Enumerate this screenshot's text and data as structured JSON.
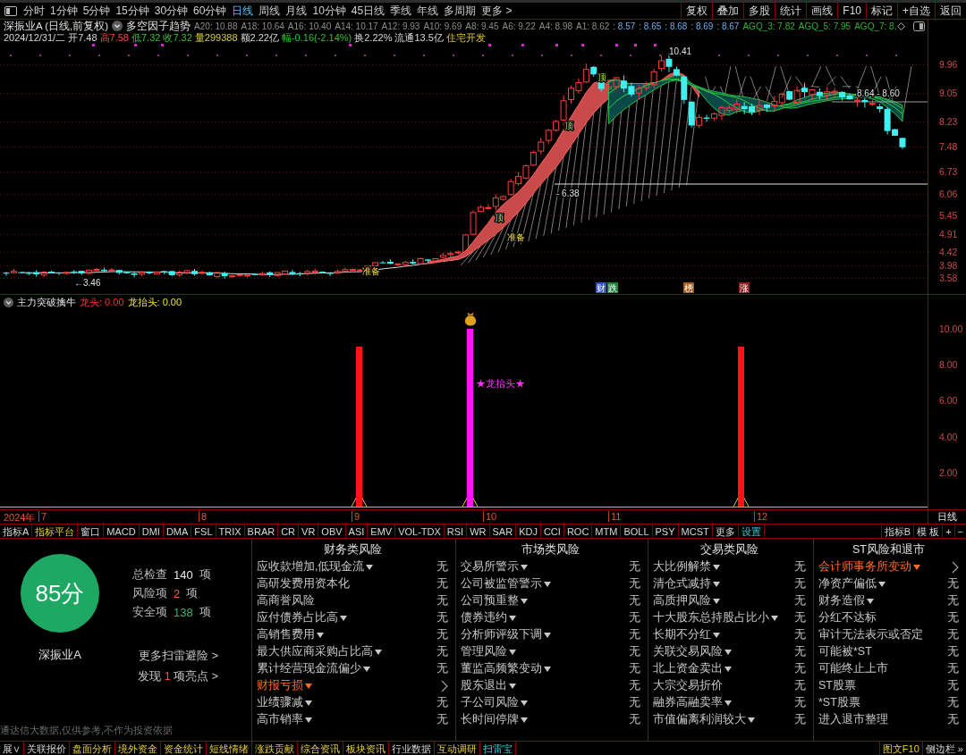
{
  "toolbar": {
    "periods": [
      {
        "label": "分时",
        "selected": false
      },
      {
        "label": "1分钟",
        "selected": false
      },
      {
        "label": "5分钟",
        "selected": false
      },
      {
        "label": "15分钟",
        "selected": false
      },
      {
        "label": "30分钟",
        "selected": false
      },
      {
        "label": "60分钟",
        "selected": false
      },
      {
        "label": "日线",
        "selected": true
      },
      {
        "label": "周线",
        "selected": false
      },
      {
        "label": "月线",
        "selected": false
      },
      {
        "label": "10分钟",
        "selected": false
      },
      {
        "label": "45日线",
        "selected": false
      },
      {
        "label": "季线",
        "selected": false
      },
      {
        "label": "年线",
        "selected": false
      },
      {
        "label": "多周期",
        "selected": false
      }
    ],
    "more": "更多 >",
    "tools": [
      "复权",
      "叠加",
      "多股",
      "统计",
      "画线",
      "F10",
      "标记",
      "+自选",
      "返回"
    ]
  },
  "quote_header": {
    "title": "深振业A (日线,前复权)",
    "indicator": "多空因子趋势",
    "indicator_values": [
      {
        "text": "A20: 10.88",
        "kind": "average"
      },
      {
        "text": "A18: 10.64",
        "kind": "average"
      },
      {
        "text": "A16: 10.40",
        "kind": "average"
      },
      {
        "text": "A14: 10.17",
        "kind": "average"
      },
      {
        "text": "A12: 9.93",
        "kind": "average"
      },
      {
        "text": "A10: 9.69",
        "kind": "average"
      },
      {
        "text": "A8: 9.45",
        "kind": "average"
      },
      {
        "text": "A6: 9.22",
        "kind": "average"
      },
      {
        "text": "A4: 8.98",
        "kind": "average"
      },
      {
        "text": "A1: 8.62",
        "kind": "average"
      },
      {
        "text": ": 8.57",
        "kind": "level"
      },
      {
        "text": ": 8.65",
        "kind": "level"
      },
      {
        "text": ": 8.68",
        "kind": "level"
      },
      {
        "text": ": 8.69",
        "kind": "level"
      },
      {
        "text": ": 8.67",
        "kind": "level"
      },
      {
        "text": "AGQ_3: 7.82",
        "kind": "agq"
      },
      {
        "text": "AGQ_5: 7.95",
        "kind": "agq"
      },
      {
        "text": "AGQ_7: 8.",
        "kind": "agq"
      }
    ],
    "quote": [
      {
        "text": "2024/12/31/二",
        "kind": "plain"
      },
      {
        "text": "开7.48",
        "kind": "plain"
      },
      {
        "text": "高7.58",
        "kind": "up"
      },
      {
        "text": "低7.32",
        "kind": "down"
      },
      {
        "text": "收7.32",
        "kind": "down"
      },
      {
        "text": "量299388",
        "kind": "volume"
      },
      {
        "text": "额2.22亿",
        "kind": "plain"
      },
      {
        "text": "幅-0.16(-2.14%)",
        "kind": "down"
      },
      {
        "text": "换2.22%",
        "kind": "plain"
      },
      {
        "text": "流通13.5亿",
        "kind": "plain"
      },
      {
        "text": "住宅开发",
        "kind": "sector"
      }
    ]
  },
  "price_chart": {
    "axis_labels": [
      "9.96",
      "9.05",
      "8.23",
      "7.48",
      "6.73",
      "6.06",
      "5.45",
      "4.91",
      "4.42",
      "3.98",
      "3.58"
    ],
    "price_labels": [
      "10.41",
      "- 6.38",
      "8.64 - 8.60",
      "←3.46"
    ],
    "signals": [
      {
        "text": "顶",
        "kind": "peak"
      },
      {
        "text": "顶",
        "kind": "peak"
      },
      {
        "text": "顶",
        "kind": "peak"
      },
      {
        "text": "准备",
        "kind": "setup"
      },
      {
        "text": "准备",
        "kind": "setup"
      }
    ],
    "badges": [
      {
        "text": "财",
        "color": "#3050c0"
      },
      {
        "text": "跌",
        "color": "#208040"
      },
      {
        "text": "榜",
        "color": "#a05a20"
      },
      {
        "text": "涨",
        "color": "#902020"
      }
    ]
  },
  "indicator_panel": {
    "name": "主力突破擒牛",
    "values": [
      {
        "text": "龙头: 0.00",
        "kind": "leader"
      },
      {
        "text": "龙抬头: 0.00",
        "kind": "rise"
      }
    ],
    "signal_label": "★龙抬头★",
    "axis_labels": [
      "10.00",
      "8.00",
      "6.00",
      "4.00",
      "2.00"
    ]
  },
  "date_axis": {
    "year": "2024年",
    "months": [
      "7",
      "8",
      "9",
      "10",
      "11",
      "12"
    ],
    "period": "日线"
  },
  "indicator_tabs": {
    "tabs": [
      {
        "label": "指标A",
        "kind": "normal"
      },
      {
        "label": "指标平台",
        "kind": "feature"
      },
      {
        "label": "窗口",
        "kind": "normal"
      },
      {
        "label": "MACD",
        "kind": "normal"
      },
      {
        "label": "DMI",
        "kind": "normal"
      },
      {
        "label": "DMA",
        "kind": "normal"
      },
      {
        "label": "FSL",
        "kind": "normal"
      },
      {
        "label": "TRIX",
        "kind": "normal"
      },
      {
        "label": "BRAR",
        "kind": "normal"
      },
      {
        "label": "CR",
        "kind": "normal"
      },
      {
        "label": "VR",
        "kind": "normal"
      },
      {
        "label": "OBV",
        "kind": "normal"
      },
      {
        "label": "ASI",
        "kind": "normal"
      },
      {
        "label": "EMV",
        "kind": "normal"
      },
      {
        "label": "VOL-TDX",
        "kind": "normal"
      },
      {
        "label": "RSI",
        "kind": "normal"
      },
      {
        "label": "WR",
        "kind": "normal"
      },
      {
        "label": "SAR",
        "kind": "normal"
      },
      {
        "label": "KDJ",
        "kind": "normal"
      },
      {
        "label": "CCI",
        "kind": "normal"
      },
      {
        "label": "ROC",
        "kind": "normal"
      },
      {
        "label": "MTM",
        "kind": "normal"
      },
      {
        "label": "BOLL",
        "kind": "normal"
      },
      {
        "label": "PSY",
        "kind": "normal"
      },
      {
        "label": "MCST",
        "kind": "normal"
      },
      {
        "label": "更多",
        "kind": "normal"
      },
      {
        "label": "设置",
        "kind": "setting"
      }
    ],
    "right": [
      "指标B",
      "模 板",
      "+",
      "−"
    ]
  },
  "risk_scan": {
    "score": "85分",
    "stock": "深振业A",
    "stats": [
      {
        "label": "总检查",
        "value": "140",
        "unit": "项",
        "kind": "total"
      },
      {
        "label": "风险项",
        "value": "2",
        "unit": "项",
        "kind": "risk"
      },
      {
        "label": "安全项",
        "value": "138",
        "unit": "项",
        "kind": "safe"
      }
    ],
    "more_link": "更多扫雷避险 >",
    "highlight": {
      "prefix": "发现",
      "count": "1",
      "suffix": "项亮点 >"
    },
    "disclaimer": "通达信大数据,仅供参考,不作为投资依据",
    "categories": [
      {
        "title": "财务类风险",
        "items": [
          {
            "label": "应收款增加,低现金流",
            "expandable": true,
            "risk": false,
            "status": "无"
          },
          {
            "label": "高研发费用资本化",
            "expandable": false,
            "risk": false,
            "status": "无"
          },
          {
            "label": "高商誉风险",
            "expandable": false,
            "risk": false,
            "status": "无"
          },
          {
            "label": "应付债券占比高",
            "expandable": true,
            "risk": false,
            "status": "无"
          },
          {
            "label": "高销售费用",
            "expandable": true,
            "risk": false,
            "status": "无"
          },
          {
            "label": "最大供应商采购占比高",
            "expandable": true,
            "risk": false,
            "status": "无"
          },
          {
            "label": "累计经营现金流偏少",
            "expandable": true,
            "risk": false,
            "status": "无"
          },
          {
            "label": "财报亏损",
            "expandable": true,
            "risk": true
          },
          {
            "label": "业绩骤减",
            "expandable": true,
            "risk": false,
            "status": "无"
          },
          {
            "label": "高市销率",
            "expandable": true,
            "risk": false,
            "status": "无"
          }
        ]
      },
      {
        "title": "市场类风险",
        "items": [
          {
            "label": "交易所警示",
            "expandable": true,
            "risk": false,
            "status": "无"
          },
          {
            "label": "公司被监管警示",
            "expandable": true,
            "risk": false,
            "status": "无"
          },
          {
            "label": "公司预重整",
            "expandable": true,
            "risk": false,
            "status": "无"
          },
          {
            "label": "债券违约",
            "expandable": true,
            "risk": false,
            "status": "无"
          },
          {
            "label": "分析师评级下调",
            "expandable": true,
            "risk": false,
            "status": "无"
          },
          {
            "label": "管理风险",
            "expandable": true,
            "risk": false,
            "status": "无"
          },
          {
            "label": "董监高频繁变动",
            "expandable": true,
            "risk": false,
            "status": "无"
          },
          {
            "label": "股东退出",
            "expandable": true,
            "risk": false,
            "status": "无"
          },
          {
            "label": "子公司风险",
            "expandable": true,
            "risk": false,
            "status": "无"
          },
          {
            "label": "长时间停牌",
            "expandable": true,
            "risk": false,
            "status": "无"
          }
        ]
      },
      {
        "title": "交易类风险",
        "items": [
          {
            "label": "大比例解禁",
            "expandable": true,
            "risk": false,
            "status": "无"
          },
          {
            "label": "清仓式减持",
            "expandable": true,
            "risk": false,
            "status": "无"
          },
          {
            "label": "高质押风险",
            "expandable": true,
            "risk": false,
            "status": "无"
          },
          {
            "label": "十大股东总持股占比小",
            "expandable": true,
            "risk": false,
            "status": "无"
          },
          {
            "label": "长期不分红",
            "expandable": true,
            "risk": false,
            "status": "无"
          },
          {
            "label": "关联交易风险",
            "expandable": true,
            "risk": false,
            "status": "无"
          },
          {
            "label": "北上资金卖出",
            "expandable": true,
            "risk": false,
            "status": "无"
          },
          {
            "label": "大宗交易折价",
            "expandable": false,
            "risk": false,
            "status": "无"
          },
          {
            "label": "融券高融卖率",
            "expandable": true,
            "risk": false,
            "status": "无"
          },
          {
            "label": "市值偏离利润较大",
            "expandable": true,
            "risk": false,
            "status": "无"
          }
        ]
      },
      {
        "title": "ST风险和退市",
        "items": [
          {
            "label": "会计师事务所变动",
            "expandable": true,
            "risk": true
          },
          {
            "label": "净资产偏低",
            "expandable": true,
            "risk": false,
            "status": "无"
          },
          {
            "label": "财务造假",
            "expandable": true,
            "risk": false,
            "status": "无"
          },
          {
            "label": "分红不达标",
            "expandable": false,
            "risk": false,
            "status": "无"
          },
          {
            "label": "审计无法表示或否定",
            "expandable": false,
            "risk": false,
            "status": "无"
          },
          {
            "label": "可能被*ST",
            "expandable": false,
            "risk": false,
            "status": "无"
          },
          {
            "label": "可能终止上市",
            "expandable": false,
            "risk": false,
            "status": "无"
          },
          {
            "label": "ST股票",
            "expandable": false,
            "risk": false,
            "status": "无"
          },
          {
            "label": "*ST股票",
            "expandable": false,
            "risk": false,
            "status": "无"
          },
          {
            "label": "进入退市整理",
            "expandable": false,
            "risk": false,
            "status": "无"
          }
        ]
      }
    ]
  },
  "bottom_tabs": {
    "tabs": [
      {
        "label": "展∨",
        "kind": "normal",
        "selected": false
      },
      {
        "label": "关联报价",
        "kind": "normal",
        "selected": false
      },
      {
        "label": "盘面分析",
        "kind": "feature",
        "selected": false
      },
      {
        "label": "境外资金",
        "kind": "feature",
        "selected": false
      },
      {
        "label": "资金统计",
        "kind": "feature",
        "selected": false
      },
      {
        "label": "短线情绪",
        "kind": "feature",
        "selected": false
      },
      {
        "label": "涨跌贡献",
        "kind": "feature",
        "selected": false
      },
      {
        "label": "综合资讯",
        "kind": "feature",
        "selected": false
      },
      {
        "label": "板块资讯",
        "kind": "feature",
        "selected": false
      },
      {
        "label": "行业数据",
        "kind": "normal",
        "selected": false
      },
      {
        "label": "互动调研",
        "kind": "feature",
        "selected": false
      },
      {
        "label": "扫雷宝",
        "selected": true
      }
    ],
    "right": [
      {
        "label": "图文F10",
        "kind": "feature"
      },
      {
        "label": "侧边栏 »",
        "kind": "normal"
      }
    ]
  }
}
